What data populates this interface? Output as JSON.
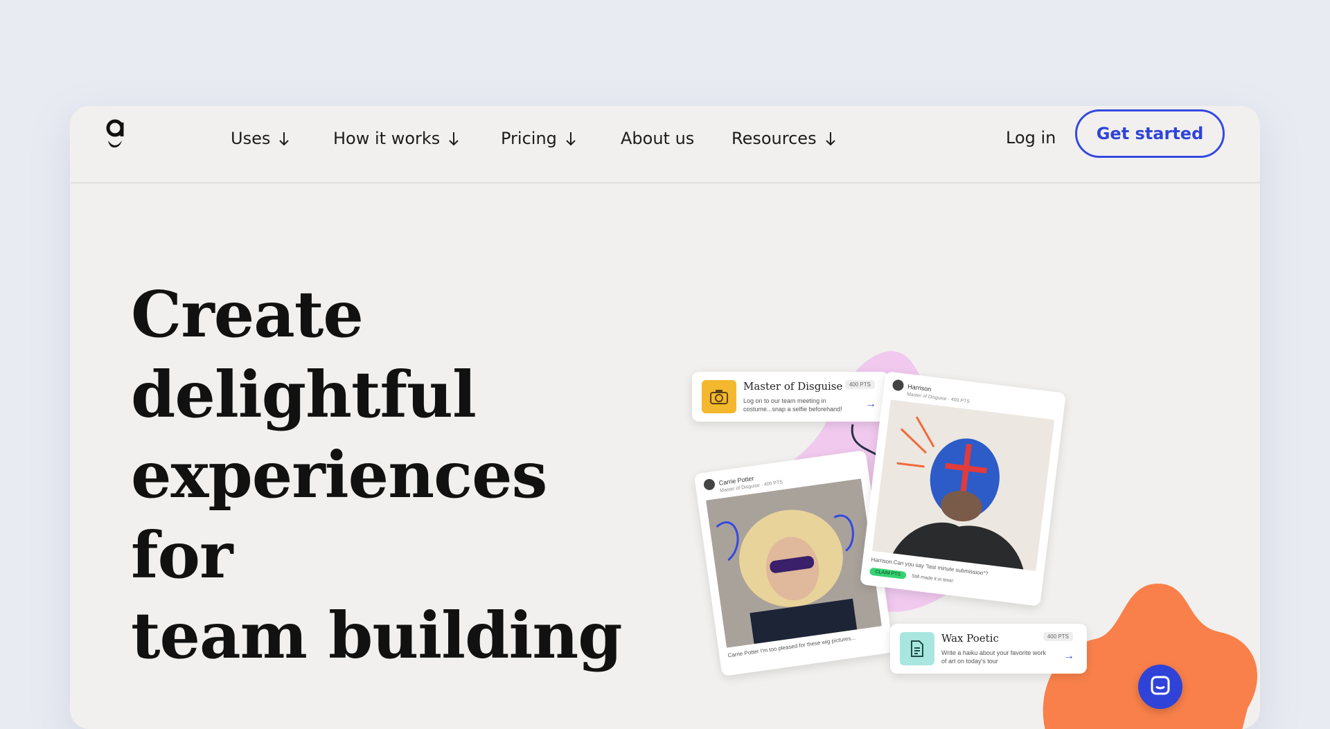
{
  "nav": {
    "logo_letter": "g",
    "items": [
      {
        "label": "Uses",
        "has_dropdown": true
      },
      {
        "label": "How it works",
        "has_dropdown": true
      },
      {
        "label": "Pricing",
        "has_dropdown": true
      },
      {
        "label": "About us",
        "has_dropdown": false
      },
      {
        "label": "Resources",
        "has_dropdown": true
      }
    ],
    "login_label": "Log in",
    "cta_label": "Get started"
  },
  "hero": {
    "headline_lines": [
      "Create",
      "delightful",
      "experiences",
      "for",
      "team building"
    ]
  },
  "mockups": {
    "task_top": {
      "title": "Master of Disguise",
      "desc": "Log on to our team meeting in costume...snap a selfie beforehand!",
      "points": "400 PTS",
      "icon": "camera-icon",
      "icon_color": "#f4b82e"
    },
    "task_bottom": {
      "title": "Wax Poetic",
      "desc": "Write a haiku about your favorite work of art on today's tour",
      "points": "400 PTS",
      "icon": "document-icon",
      "icon_color": "#a8e6df"
    },
    "photo_left": {
      "name": "Carrie Potter",
      "sub": "Master of Disguise · 400 PTS",
      "caption": "Carrie Potter I'm too pleased for these wig pictures..."
    },
    "photo_right": {
      "name": "Harrison",
      "sub": "Master of Disguise · 400 PTS",
      "caption": "Harrison Can you say \"last minute submission\"?",
      "badge": "CLAIM PTS",
      "badge_note": "Still made it in time!"
    }
  },
  "colors": {
    "accent_blue": "#2f43d8",
    "blob_pink": "#f1c9ef",
    "blob_orange": "#f9804a",
    "card_bg": "#f1f0ee",
    "page_bg": "#e8ebf2"
  }
}
